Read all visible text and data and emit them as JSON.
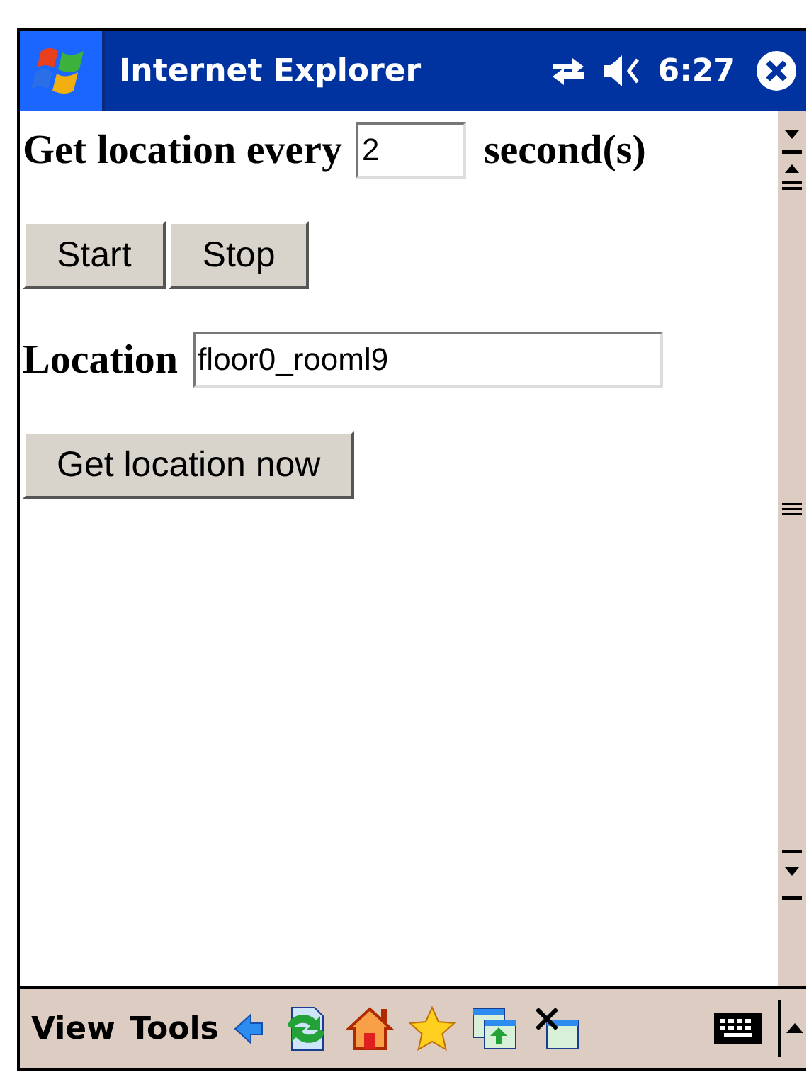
{
  "window": {
    "title": "Internet Explorer",
    "time": "6:27"
  },
  "form": {
    "interval_label": "Get location every",
    "interval_value": "2",
    "interval_unit": "second(s)",
    "buttons": [
      "Start",
      "Stop"
    ],
    "location_label": "Location",
    "location_value": "floor0_rooml9",
    "action_button": "Get location now"
  },
  "menu_bar": {
    "items": [
      "View",
      "Tools"
    ]
  }
}
